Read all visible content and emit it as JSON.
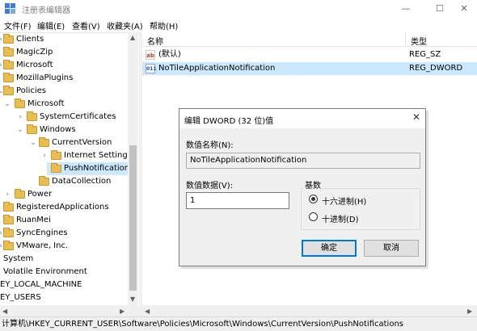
{
  "window": {
    "title": "注册表编辑器",
    "minimize": "—",
    "maximize": "☐",
    "close": "✕"
  },
  "menu": [
    "文件(F)",
    "编辑(E)",
    "查看(V)",
    "收藏夹(A)",
    "帮助(H)"
  ],
  "tree": [
    {
      "label": "Clients",
      "arrow": "›"
    },
    {
      "label": "MagicZip",
      "arrow": ""
    },
    {
      "label": "Microsoft",
      "arrow": "›"
    },
    {
      "label": "MozillaPlugins",
      "arrow": ""
    },
    {
      "label": "Policies",
      "arrow": "⌄"
    },
    {
      "label": "Microsoft",
      "arrow": "⌄"
    },
    {
      "label": "SystemCertificates",
      "arrow": "›"
    },
    {
      "label": "Windows",
      "arrow": "⌄"
    },
    {
      "label": "CurrentVersion",
      "arrow": "⌄"
    },
    {
      "label": "Internet Settings",
      "arrow": "›"
    },
    {
      "label": "PushNotifications",
      "arrow": ""
    },
    {
      "label": "DataCollection",
      "arrow": ""
    },
    {
      "label": "Power",
      "arrow": "›"
    },
    {
      "label": "RegisteredApplications",
      "arrow": ""
    },
    {
      "label": "RuanMei",
      "arrow": ""
    },
    {
      "label": "SyncEngines",
      "arrow": "›"
    },
    {
      "label": "VMware, Inc.",
      "arrow": "›"
    },
    {
      "label": "System",
      "arrow": ""
    },
    {
      "label": "Volatile Environment",
      "arrow": ""
    },
    {
      "label": "EY_LOCAL_MACHINE",
      "arrow": ""
    },
    {
      "label": "EY_USERS",
      "arrow": ""
    }
  ],
  "list": {
    "columns": {
      "name": "名称",
      "type": "类型"
    },
    "rows": [
      {
        "icon": "ab",
        "name": "(默认)",
        "type": "REG_SZ"
      },
      {
        "icon": "011",
        "name": "NoTileApplicationNotification",
        "type": "REG_DWORD"
      }
    ]
  },
  "dialog": {
    "title": "编辑 DWORD (32 位)值",
    "close": "✕",
    "name_label": "数值名称(N):",
    "name_value": "NoTileApplicationNotification",
    "data_label": "数值数据(V):",
    "data_value": "1",
    "base_label": "基数",
    "hex_label": "十六进制(H)",
    "dec_label": "十进制(D)",
    "base_selected": "hex",
    "ok": "确定",
    "cancel": "取消"
  },
  "status": "计算机\\HKEY_CURRENT_USER\\Software\\Policies\\Microsoft\\Windows\\CurrentVersion\\PushNotifications",
  "colors": {
    "selection": "#cce8ff",
    "folder": "#e8bd53",
    "accent": "#0078d7"
  }
}
